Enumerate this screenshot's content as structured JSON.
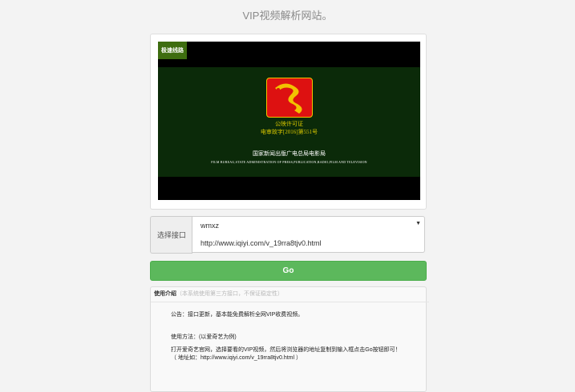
{
  "page": {
    "title": "VIP视频解析网站。"
  },
  "player": {
    "line_tag": "极速线路",
    "cert_title": "公映许可证",
    "cert_number": "电审故字[2016]第551号",
    "bureau_cn": "国家新闻出版广电总局电影局",
    "bureau_en": "FILM BUREAU,STATE ADMINISTRATION OF PRESS,PUBLICATION,RADIO,FILM AND TELEVISION"
  },
  "form": {
    "interface_label": "选择接口",
    "selected_interface": "wmxz",
    "url_value": "http://www.iqiyi.com/v_19rra8tjv0.html",
    "go_label": "Go"
  },
  "intro": {
    "heading": "使用介绍",
    "subheading": "（本系统使用第三方接口，不保证稳定性）",
    "notice": "公告：接口更新，基本能免费解析全网VIP收费视频。",
    "method_title": "使用方法：(以爱奇艺为例)",
    "step": "打开爱奇艺官网，选择要看的VIP视频，然后将浏览器的地址复制到输入框点击Go按钮即可！",
    "example": "（ 地址如：http://www.iqiyi.com/v_19rra8tjv0.html ）"
  },
  "colors": {
    "go_button": "#5cb85c",
    "screen_bg": "#0b2a09",
    "logo_red": "#dd1111",
    "logo_gold": "#f2c200"
  }
}
